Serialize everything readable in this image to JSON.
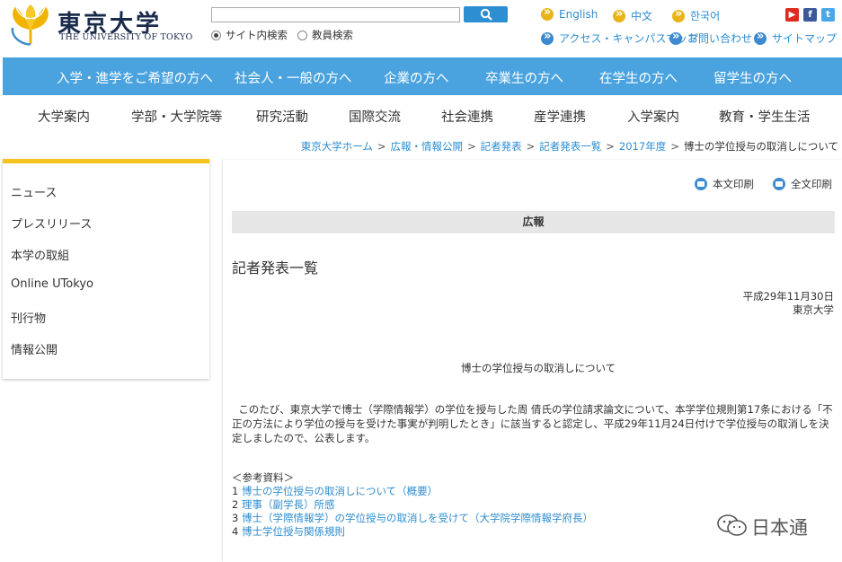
{
  "header": {
    "logo_ja": "東京大学",
    "logo_en": "THE UNIVERSITY OF TOKYO",
    "search": {
      "value": "",
      "button_icon": "search-icon"
    },
    "search_options": [
      "サイト内検索",
      "教員検索"
    ],
    "selected_search_option": "サイト内検索",
    "languages": [
      "English",
      "中文",
      "한국어"
    ],
    "utility_links": [
      "アクセス・キャンパスマップ",
      "お問い合わせ",
      "サイトマップ"
    ],
    "social_icons": [
      "youtube-icon",
      "facebook-icon",
      "twitter-icon"
    ],
    "colors": {
      "accent_blue": "#4aa3df",
      "link_blue": "#2d8ed1",
      "accent_yellow": "#f5c31d"
    }
  },
  "primary_nav": [
    "入学・進学をご希望の方へ",
    "社会人・一般の方へ",
    "企業の方へ",
    "卒業生の方へ",
    "在学生の方へ",
    "留学生の方へ"
  ],
  "secondary_nav": [
    "大学案内",
    "学部・大学院等",
    "研究活動",
    "国際交流",
    "社会連携",
    "産学連携",
    "入学案内",
    "教育・学生生活"
  ],
  "breadcrumb": [
    "東京大学ホーム",
    "広報・情報公開",
    "記者発表",
    "記者発表一覧",
    "2017年度"
  ],
  "breadcrumb_current": "博士の学位授与の取消しについて",
  "breadcrumb_sep": ">",
  "sidebar": [
    "ニュース",
    "プレスリリース",
    "本学の取組",
    "Online UTokyo",
    "刊行物",
    "情報公開"
  ],
  "print": {
    "body": "本文印刷",
    "full": "全文印刷"
  },
  "main": {
    "section": "広報",
    "page_title": "記者発表一覧",
    "date": "平成29年11月30日",
    "issuer": "東京大学",
    "doc_title": "博士の学位授与の取消しについて",
    "body": "このたび、東京大学で博士（学際情報学）の学位を授与した周 倩氏の学位請求論文について、本学学位規則第17条における「不正の方法により学位の授与を受けた事実が判明したとき」に該当すると認定し、平成29年11月24日付けで学位授与の取消しを決定しましたので、公表します。",
    "refs_heading": "＜参考資料＞",
    "refs": [
      {
        "num": "1",
        "label": "博士の学位授与の取消しについて（概要）"
      },
      {
        "num": "2",
        "label": "理事（副学長）所感"
      },
      {
        "num": "3",
        "label": "博士（学際情報学）の学位授与の取消しを受けて（大学院学際情報学府長）"
      },
      {
        "num": "4",
        "label": "博士学位授与関係規則"
      }
    ]
  },
  "watermark": {
    "text": "日本通",
    "icon": "chat-icon"
  }
}
